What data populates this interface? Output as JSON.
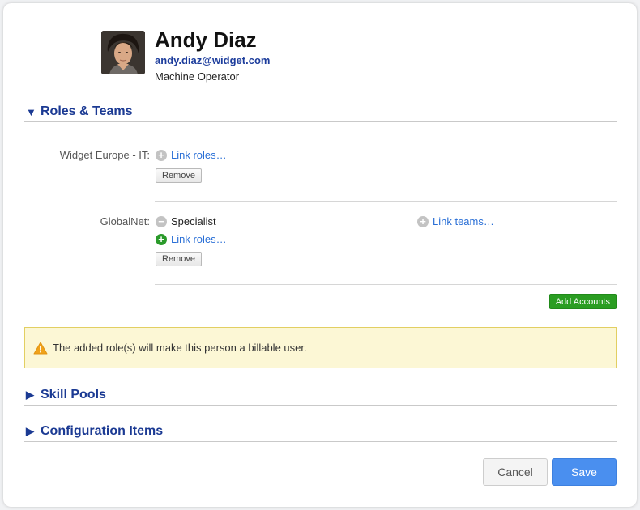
{
  "profile": {
    "name": "Andy Diaz",
    "email": "andy.diaz@widget.com",
    "job_title": "Machine Operator"
  },
  "sections": {
    "roles_teams": {
      "title": "Roles & Teams",
      "expanded": true
    },
    "skill_pools": {
      "title": "Skill Pools",
      "expanded": false
    },
    "configuration_items": {
      "title": "Configuration Items",
      "expanded": false
    }
  },
  "accounts": [
    {
      "label": "Widget Europe - IT:",
      "link_roles": "Link roles…",
      "remove": "Remove"
    },
    {
      "label": "GlobalNet:",
      "role": "Specialist",
      "link_teams": "Link teams…",
      "link_roles": "Link roles…",
      "remove": "Remove"
    }
  ],
  "add_accounts": "Add Accounts",
  "warning": {
    "text": "The added role(s) will make this person a billable user."
  },
  "footer": {
    "cancel": "Cancel",
    "save": "Save"
  },
  "colors": {
    "section_title": "#1b3a93",
    "link": "#2a6fd6",
    "add_accounts_bg": "#2a9d22",
    "save_bg": "#4a8fef",
    "warning_bg": "#fcf7d5",
    "warning_border": "#e2cf62"
  }
}
